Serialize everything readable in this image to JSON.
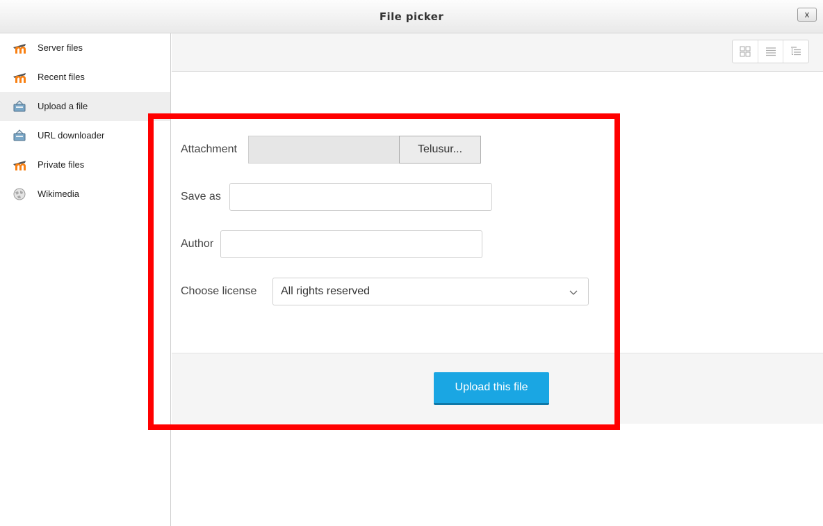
{
  "window": {
    "title": "File picker",
    "close_label": "x"
  },
  "sidebar": {
    "items": [
      {
        "label": "Server files",
        "icon": "moodle-icon"
      },
      {
        "label": "Recent files",
        "icon": "moodle-icon"
      },
      {
        "label": "Upload a file",
        "icon": "upload-icon",
        "active": true
      },
      {
        "label": "URL downloader",
        "icon": "url-download-icon"
      },
      {
        "label": "Private files",
        "icon": "moodle-icon"
      },
      {
        "label": "Wikimedia",
        "icon": "wikimedia-icon"
      }
    ]
  },
  "toolbar": {
    "views": [
      "icon-view-icon",
      "list-view-icon",
      "tree-view-icon"
    ]
  },
  "form": {
    "attachment_label": "Attachment",
    "browse_label": "Telusur...",
    "save_as_label": "Save as",
    "save_as_value": "",
    "author_label": "Author",
    "author_value": "",
    "license_label": "Choose license",
    "license_value": "All rights reserved",
    "submit_label": "Upload this file"
  },
  "colors": {
    "accent": "#1aa6e3",
    "highlight": "#ff0000",
    "moodle_orange": "#f98012"
  }
}
